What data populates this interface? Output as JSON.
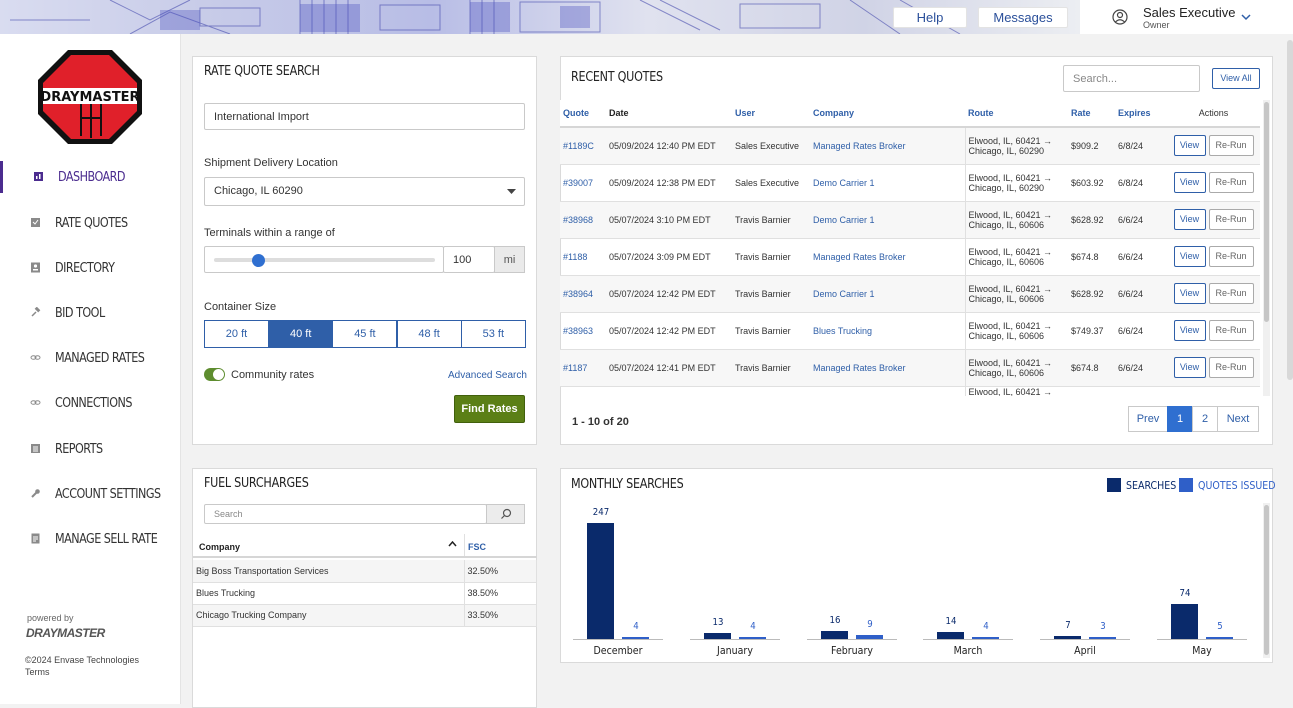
{
  "header": {
    "help_label": "Help",
    "messages_label": "Messages",
    "user_name": "Sales Executive",
    "user_role": "Owner"
  },
  "sidebar": {
    "logo_text": "DRAYMASTER",
    "items": [
      {
        "label": "DASHBOARD",
        "icon": "dashboard-icon",
        "active": true
      },
      {
        "label": "RATE QUOTES",
        "icon": "rate-quotes-icon"
      },
      {
        "label": "DIRECTORY",
        "icon": "directory-icon"
      },
      {
        "label": "BID TOOL",
        "icon": "gavel-icon"
      },
      {
        "label": "MANAGED RATES",
        "icon": "link-icon"
      },
      {
        "label": "CONNECTIONS",
        "icon": "link-icon"
      },
      {
        "label": "REPORTS",
        "icon": "reports-icon"
      },
      {
        "label": "ACCOUNT SETTINGS",
        "icon": "wrench-icon"
      },
      {
        "label": "MANAGE SELL RATE",
        "icon": "sell-rate-icon"
      }
    ],
    "powered_by": "powered by",
    "powered_brand": "DRAYMASTER",
    "copyright": "©2024 Envase Technologies",
    "terms": "Terms"
  },
  "rate_quote": {
    "title": "RATE QUOTE SEARCH",
    "type_value": "International Import",
    "delivery_label": "Shipment Delivery Location",
    "delivery_value": "Chicago, IL 60290",
    "range_label": "Terminals within a range of",
    "range_value": "100",
    "range_unit": "mi",
    "range_fraction": 0.2,
    "container_label": "Container Size",
    "sizes": [
      "20 ft",
      "40 ft",
      "45 ft",
      "48 ft",
      "53 ft"
    ],
    "selected_size": "40 ft",
    "community_label": "Community rates",
    "advanced_label": "Advanced Search",
    "find_label": "Find Rates"
  },
  "recent_quotes": {
    "title": "RECENT QUOTES",
    "search_placeholder": "Search...",
    "view_all_label": "View All",
    "columns": [
      "Quote",
      "Date",
      "User",
      "Company",
      "Route",
      "Rate",
      "Expires",
      "Actions"
    ],
    "rows": [
      {
        "quote": "#1189C",
        "date": "05/09/2024 12:40 PM EDT",
        "user": "Sales Executive",
        "company": "Managed Rates Broker",
        "route1": "Elwood, IL, 60421 →",
        "route2": "Chicago, IL, 60290",
        "rate": "$909.2",
        "expires": "6/8/24"
      },
      {
        "quote": "#39007",
        "date": "05/09/2024 12:38 PM EDT",
        "user": "Sales Executive",
        "company": "Demo Carrier 1",
        "route1": "Elwood, IL, 60421 →",
        "route2": "Chicago, IL, 60290",
        "rate": "$603.92",
        "expires": "6/8/24"
      },
      {
        "quote": "#38968",
        "date": "05/07/2024 3:10 PM EDT",
        "user": "Travis Barnier",
        "company": "Demo Carrier 1",
        "route1": "Elwood, IL, 60421 →",
        "route2": "Chicago, IL, 60606",
        "rate": "$628.92",
        "expires": "6/6/24"
      },
      {
        "quote": "#1188",
        "date": "05/07/2024 3:09 PM EDT",
        "user": "Travis Barnier",
        "company": "Managed Rates Broker",
        "route1": "Elwood, IL, 60421 →",
        "route2": "Chicago, IL, 60606",
        "rate": "$674.8",
        "expires": "6/6/24"
      },
      {
        "quote": "#38964",
        "date": "05/07/2024 12:42 PM EDT",
        "user": "Travis Barnier",
        "company": "Demo Carrier 1",
        "route1": "Elwood, IL, 60421 →",
        "route2": "Chicago, IL, 60606",
        "rate": "$628.92",
        "expires": "6/6/24"
      },
      {
        "quote": "#38963",
        "date": "05/07/2024 12:42 PM EDT",
        "user": "Travis Barnier",
        "company": "Blues Trucking",
        "route1": "Elwood, IL, 60421 →",
        "route2": "Chicago, IL, 60606",
        "rate": "$749.37",
        "expires": "6/6/24"
      },
      {
        "quote": "#1187",
        "date": "05/07/2024 12:41 PM EDT",
        "user": "Travis Barnier",
        "company": "Managed Rates Broker",
        "route1": "Elwood, IL, 60421 →",
        "route2": "Chicago, IL, 60606",
        "rate": "$674.8",
        "expires": "6/6/24"
      }
    ],
    "partial_route": "Elwood, IL, 60421 →",
    "view_label": "View",
    "rerun_label": "Re-Run",
    "range_text": "1 - 10 of 20",
    "pagination": {
      "prev": "Prev",
      "pages": [
        "1",
        "2"
      ],
      "current": "1",
      "next": "Next"
    }
  },
  "fuel": {
    "title": "FUEL SURCHARGES",
    "search_placeholder": "Search",
    "col_company": "Company",
    "col_fsc": "FSC",
    "rows": [
      {
        "company": "Big Boss Transportation Services",
        "fsc": "32.50%"
      },
      {
        "company": "Blues Trucking",
        "fsc": "38.50%"
      },
      {
        "company": "Chicago Trucking Company",
        "fsc": "33.50%"
      }
    ]
  },
  "monthly": {
    "title": "MONTHLY SEARCHES",
    "legend_searches": "SEARCHES",
    "legend_quotes": "QUOTES ISSUED",
    "color_searches": "#0a2a6b",
    "color_quotes": "#2f5fc8"
  },
  "chart_data": {
    "type": "bar",
    "categories": [
      "December",
      "January",
      "February",
      "March",
      "April",
      "May"
    ],
    "series": [
      {
        "name": "SEARCHES",
        "values": [
          247,
          13,
          16,
          14,
          7,
          74
        ]
      },
      {
        "name": "QUOTES ISSUED",
        "values": [
          4,
          4,
          9,
          4,
          3,
          5
        ]
      }
    ],
    "legend": "top-right",
    "grid": false
  }
}
